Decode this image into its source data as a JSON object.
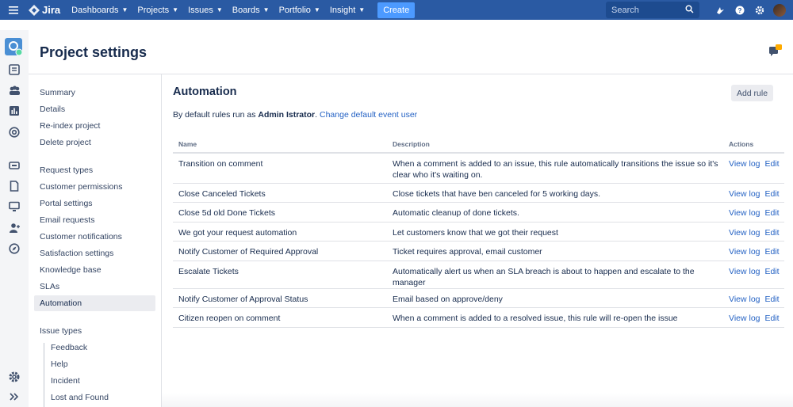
{
  "topbar": {
    "product": "Jira",
    "nav": [
      "Dashboards",
      "Projects",
      "Issues",
      "Boards",
      "Portfolio",
      "Insight"
    ],
    "create_label": "Create",
    "search_placeholder": "Search"
  },
  "header": {
    "title": "Project settings"
  },
  "leftnav": {
    "group1": [
      "Summary",
      "Details",
      "Re-index project",
      "Delete project"
    ],
    "group2": [
      "Request types",
      "Customer permissions",
      "Portal settings",
      "Email requests",
      "Customer notifications",
      "Satisfaction settings",
      "Knowledge base",
      "SLAs",
      "Automation"
    ],
    "issue_types_label": "Issue types",
    "issue_types": [
      "Feedback",
      "Help",
      "Incident",
      "Lost and Found"
    ]
  },
  "automation": {
    "title": "Automation",
    "add_rule_label": "Add rule",
    "default_text": "By default rules run as ",
    "default_user": "Admin Istrator",
    "default_period": ".",
    "change_link": "Change default event user",
    "columns": {
      "name": "Name",
      "description": "Description",
      "actions": "Actions"
    },
    "action_labels": {
      "view_log": "View log",
      "edit": "Edit"
    },
    "rules": [
      {
        "name": "Transition on comment",
        "description": "When a comment is added to an issue, this rule automatically transitions the issue so it's clear who it's waiting on."
      },
      {
        "name": "Close Canceled Tickets",
        "description": "Close tickets that have ben canceled for 5 working days."
      },
      {
        "name": "Close 5d old Done Tickets",
        "description": "Automatic cleanup of done tickets."
      },
      {
        "name": "We got your request automation",
        "description": "Let customers know that we got their request"
      },
      {
        "name": "Notify Customer of Required Approval",
        "description": "Ticket requires approval, email customer"
      },
      {
        "name": "Escalate Tickets",
        "description": "Automatically alert us when an SLA breach is about to happen and escalate to the manager"
      },
      {
        "name": "Notify Customer of Approval Status",
        "description": "Email based on approve/deny"
      },
      {
        "name": "Citizen reopen on comment",
        "description": "When a comment is added to a resolved issue, this rule will re-open the issue"
      }
    ]
  },
  "colors": {
    "topbar": "#2a5aa3",
    "link": "#2462c4",
    "create": "#4c9aff"
  }
}
